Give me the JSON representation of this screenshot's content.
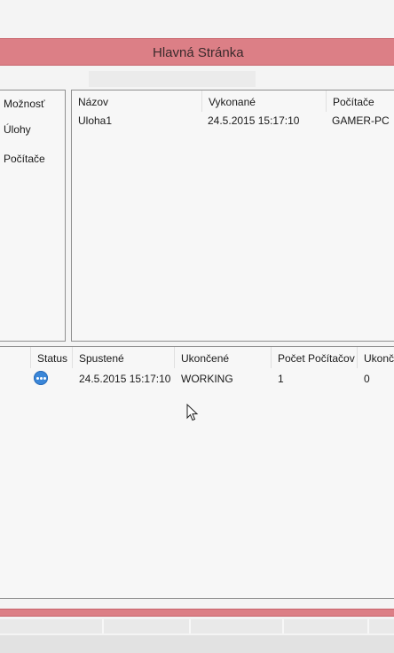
{
  "window": {
    "title": "Hlavná Stránka"
  },
  "menu": {
    "items": [
      {
        "label": "Možnosť"
      },
      {
        "label": "Úlohy"
      },
      {
        "label": "Počítače"
      }
    ]
  },
  "tasks_table": {
    "columns": [
      "Názov",
      "Vykonané",
      "Počítače"
    ],
    "rows": [
      [
        "Uloha1",
        "24.5.2015 15:17:10",
        "GAMER-PC"
      ]
    ]
  },
  "runs_table": {
    "columns": [
      "Status",
      "Spustené",
      "Ukončené",
      "Počet Počítačov",
      "Ukonč"
    ],
    "rows": [
      {
        "status_icon": "running-dots-icon",
        "cells": [
          "24.5.2015 15:17:10",
          "WORKING",
          "1",
          "0"
        ]
      }
    ]
  },
  "colors": {
    "accent_bar": "#dc7f86",
    "status_icon": "#3a86d8"
  }
}
